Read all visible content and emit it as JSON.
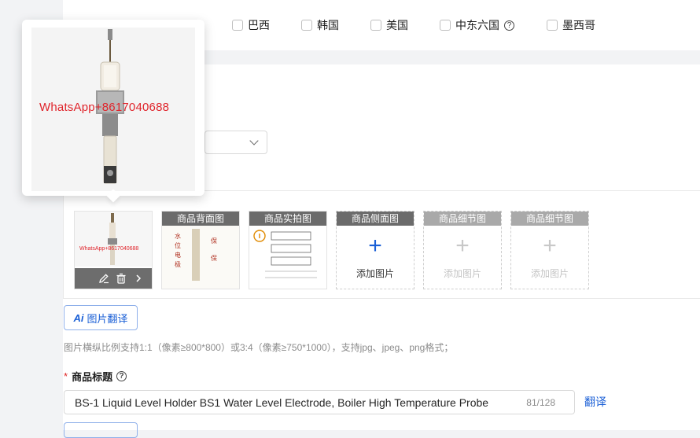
{
  "countries": {
    "items": [
      {
        "label": "巴西",
        "checked": false
      },
      {
        "label": "韩国",
        "checked": false
      },
      {
        "label": "美国",
        "checked": false
      },
      {
        "label": "中东六国",
        "checked": false,
        "help": true
      },
      {
        "label": "墨西哥",
        "checked": false
      }
    ],
    "help_glyph": "?"
  },
  "images": {
    "main": {
      "watermark": "WhatsApp+8617040688"
    },
    "slots": [
      {
        "label": "商品背面图",
        "filled": true
      },
      {
        "label": "商品实拍图",
        "filled": true
      },
      {
        "label": "商品侧面图",
        "filled": false,
        "add_text": "添加图片",
        "plus": "+",
        "enabled": true
      },
      {
        "label": "商品细节图",
        "filled": false,
        "add_text": "添加图片",
        "plus": "+",
        "enabled": false
      },
      {
        "label": "商品细节图",
        "filled": false,
        "add_text": "添加图片",
        "plus": "+",
        "enabled": false
      }
    ],
    "translate_button": {
      "ai": "Ai",
      "label": "图片翻译"
    },
    "hint": "图片横纵比例支持1:1（像素≥800*800）或3:4（像素≥750*1000），支持jpg、jpeg、png格式；"
  },
  "product_title": {
    "required_mark": "*",
    "label": "商品标题",
    "help_glyph": "?",
    "value": "BS-1 Liquid Level Holder BS1 Water Level Electrode, Boiler High Temperature Probe",
    "count": "81/128",
    "translate_link": "翻译"
  },
  "popover": {
    "watermark": "WhatsApp+8617040688"
  },
  "colors": {
    "accent": "#1a5fd6",
    "watermark": "#e0242b",
    "label_bg": "#6b6b6b"
  }
}
